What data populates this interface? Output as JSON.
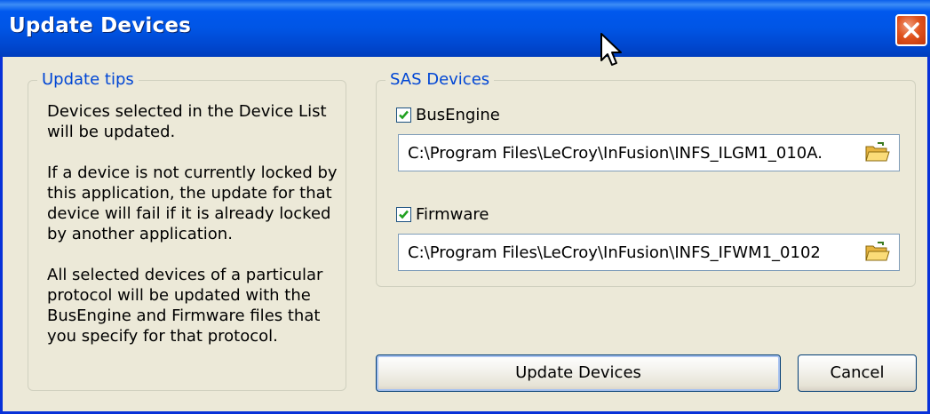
{
  "window": {
    "title": "Update Devices"
  },
  "tips": {
    "legend": "Update tips",
    "paragraphs": [
      "Devices selected in the Device List will be updated.",
      "If a device is not currently locked by this application, the update for that device will fail if it is already locked by another application.",
      "All selected devices of a particular protocol will be updated with the BusEngine and Firmware files that you specify for that protocol."
    ]
  },
  "sas": {
    "legend": "SAS Devices",
    "busengine": {
      "label": "BusEngine",
      "checked": true,
      "path": "C:\\Program Files\\LeCroy\\InFusion\\INFS_ILGM1_010A."
    },
    "firmware": {
      "label": "Firmware",
      "checked": true,
      "path": "C:\\Program Files\\LeCroy\\InFusion\\INFS_IFWM1_0102"
    }
  },
  "buttons": {
    "update": "Update Devices",
    "cancel": "Cancel"
  }
}
